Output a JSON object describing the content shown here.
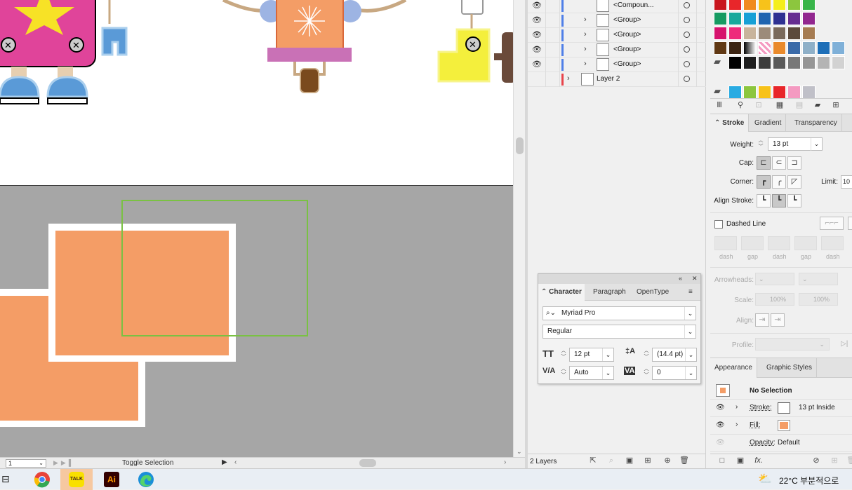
{
  "status_bar": {
    "zoom_value": "1",
    "status_text": "Toggle Selection"
  },
  "layers_panel": {
    "rows": [
      {
        "name": "<Compoun..."
      },
      {
        "name": "<Group>"
      },
      {
        "name": "<Group>"
      },
      {
        "name": "<Group>"
      },
      {
        "name": "<Group>"
      },
      {
        "name": "Layer 2"
      }
    ],
    "layer_count": "2 Layers"
  },
  "character_panel": {
    "tabs": [
      "Character",
      "Paragraph",
      "OpenType"
    ],
    "font_family": "Myriad Pro",
    "font_style": "Regular",
    "font_size": "12 pt",
    "leading": "(14.4 pt)",
    "kerning": "Auto",
    "tracking": "0"
  },
  "stroke_panel": {
    "tabs": [
      "Stroke",
      "Gradient",
      "Transparency"
    ],
    "weight_label": "Weight:",
    "weight_value": "13 pt",
    "cap_label": "Cap:",
    "corner_label": "Corner:",
    "limit_label": "Limit:",
    "limit_value": "10",
    "align_label": "Align Stroke:",
    "dashed_label": "Dashed Line",
    "dash_labels": [
      "dash",
      "gap",
      "dash",
      "gap",
      "dash"
    ],
    "arrowheads_label": "Arrowheads:",
    "scale_label": "Scale:",
    "scale_values": [
      "100%",
      "100%"
    ],
    "align_arrow_label": "Align:",
    "profile_label": "Profile:"
  },
  "appearance_panel": {
    "tabs": [
      "Appearance",
      "Graphic Styles"
    ],
    "selection_label": "No Selection",
    "stroke_label": "Stroke:",
    "stroke_value": "13 pt  Inside",
    "fill_label": "Fill:",
    "opacity_label": "Opacity:",
    "opacity_value": "Default"
  },
  "taskbar": {
    "weather_text": "22°C  부분적으로"
  },
  "colors": {
    "accent_orange": "#f49d66",
    "selection_green": "#7ac143",
    "canvas_gray": "#a6a6a6",
    "layer_blue": "#4f7fe8",
    "layer_red": "#e8434a"
  },
  "swatch_rows": [
    [
      "#c8161e",
      "#e8262a",
      "#f08a1e",
      "#f7c21a",
      "#f4ee1c",
      "#8cc63e",
      "#39b54a"
    ],
    [
      "#169b62",
      "#18a99c",
      "#16a0d6",
      "#1f64b0",
      "#2e3192",
      "#662d91",
      "#92278f"
    ],
    [
      "#d6126d",
      "#ee2a7b",
      "#c8b49c",
      "#9c8b7a",
      "#7a6a5c",
      "#5c4a3c",
      "#a67c52"
    ],
    [
      "#603813",
      "#3c2412",
      "#gradient",
      "#pattern",
      "#e98a2c",
      "#3a6aa8",
      "#8fb0c8"
    ],
    [
      "#folder",
      "#000000",
      "#1e1e1e",
      "#3c3c3c",
      "#5a5a5a",
      "#787878",
      "#969696"
    ],
    [
      "#folder",
      "#29abe2",
      "#8cc63e",
      "#f7c21a",
      "#e8262a",
      "#f49ac1",
      "#c0c0c8"
    ]
  ]
}
